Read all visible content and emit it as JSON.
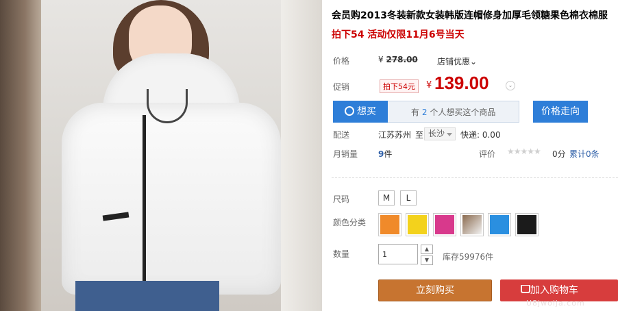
{
  "product": {
    "title": "会员购2013冬装新款女装韩版连帽修身加厚毛领糖果色棉衣棉服",
    "subtitle": "拍下54 活动仅限11月6号当天"
  },
  "price": {
    "label": "价格",
    "currency": "¥",
    "original": "278.00",
    "shop_discount": "店铺优惠"
  },
  "promo": {
    "label": "促销",
    "badge": "拍下54元",
    "currency": "¥",
    "price": "139.00"
  },
  "want": {
    "button": "想买",
    "text_prefix": "有",
    "count": "2",
    "text_suffix": "个人想买这个商品"
  },
  "trend_button": "价格走向",
  "shipping": {
    "label": "配送",
    "from": "江苏苏州",
    "to_word": "至",
    "destination": "长沙",
    "fee": "快递: 0.00"
  },
  "sales": {
    "label": "月销量",
    "count": "9",
    "unit": "件",
    "rating_label": "评价",
    "stars": "★★★★★",
    "score": "0分",
    "reviews": "累计0条"
  },
  "size": {
    "label": "尺码",
    "options": [
      "M",
      "L"
    ]
  },
  "color": {
    "label": "颜色分类",
    "swatches": [
      "#f08a2a",
      "#f3d21c",
      "#d8398c",
      "#8a6a4e",
      "#2a8fe0",
      "#1b1b1b"
    ]
  },
  "quantity": {
    "label": "数量",
    "value": "1",
    "stock": "库存59976件"
  },
  "actions": {
    "buy": "立刻购买",
    "cart": "加入购物车"
  },
  "watermark": "U8jwoija.com"
}
